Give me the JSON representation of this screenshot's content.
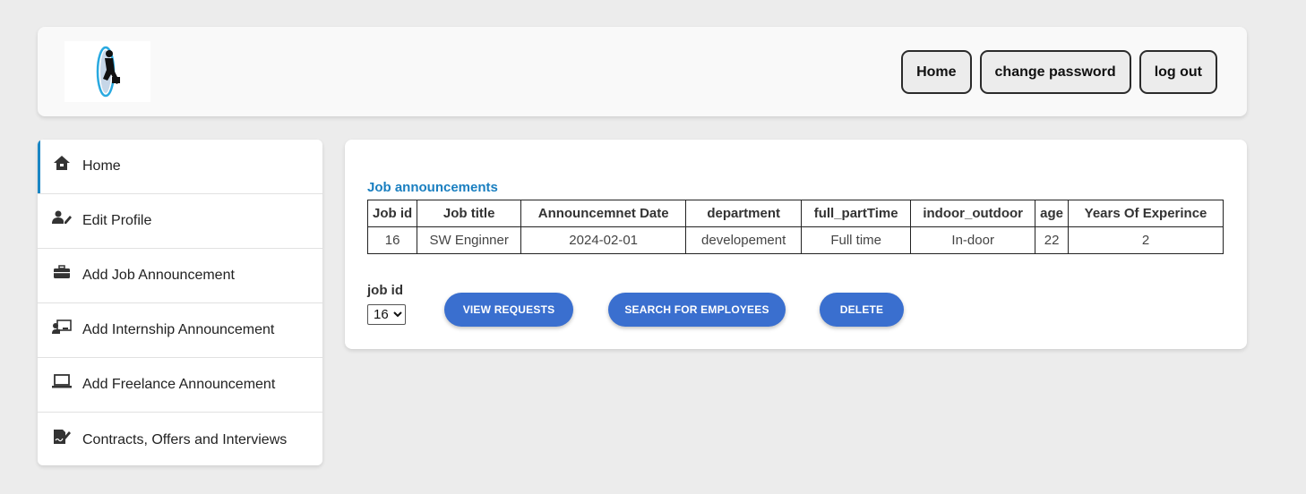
{
  "header": {
    "nav": [
      {
        "label": "Home"
      },
      {
        "label": "change password"
      },
      {
        "label": "log out"
      }
    ]
  },
  "sidebar": {
    "items": [
      {
        "label": "Home",
        "icon": "home-icon"
      },
      {
        "label": "Edit Profile",
        "icon": "user-edit-icon"
      },
      {
        "label": "Add Job Announcement",
        "icon": "briefcase-icon"
      },
      {
        "label": "Add Internship Announcement",
        "icon": "chalkboard-teacher-icon"
      },
      {
        "label": "Add Freelance Announcement",
        "icon": "laptop-icon"
      },
      {
        "label": "Contracts, Offers and Interviews",
        "icon": "file-signature-icon"
      }
    ]
  },
  "main": {
    "title": "Job announcements",
    "table": {
      "columns": [
        "Job id",
        "Job title",
        "Announcemnet Date",
        "department",
        "full_partTime",
        "indoor_outdoor",
        "age",
        "Years Of Experince"
      ],
      "rows": [
        [
          "16",
          "SW Enginner",
          "2024-02-01",
          "developement",
          "Full time",
          "In-door",
          "22",
          "2"
        ]
      ]
    },
    "job_id_label": "job id",
    "job_id_selected": "16",
    "buttons": {
      "view_requests": "VIEW REQUESTS",
      "search_employees": "SEARCH FOR EMPLOYEES",
      "delete": "DELETE"
    }
  },
  "colors": {
    "accent": "#1a7fc0",
    "button": "#3a6fcf",
    "background": "#ececec"
  }
}
